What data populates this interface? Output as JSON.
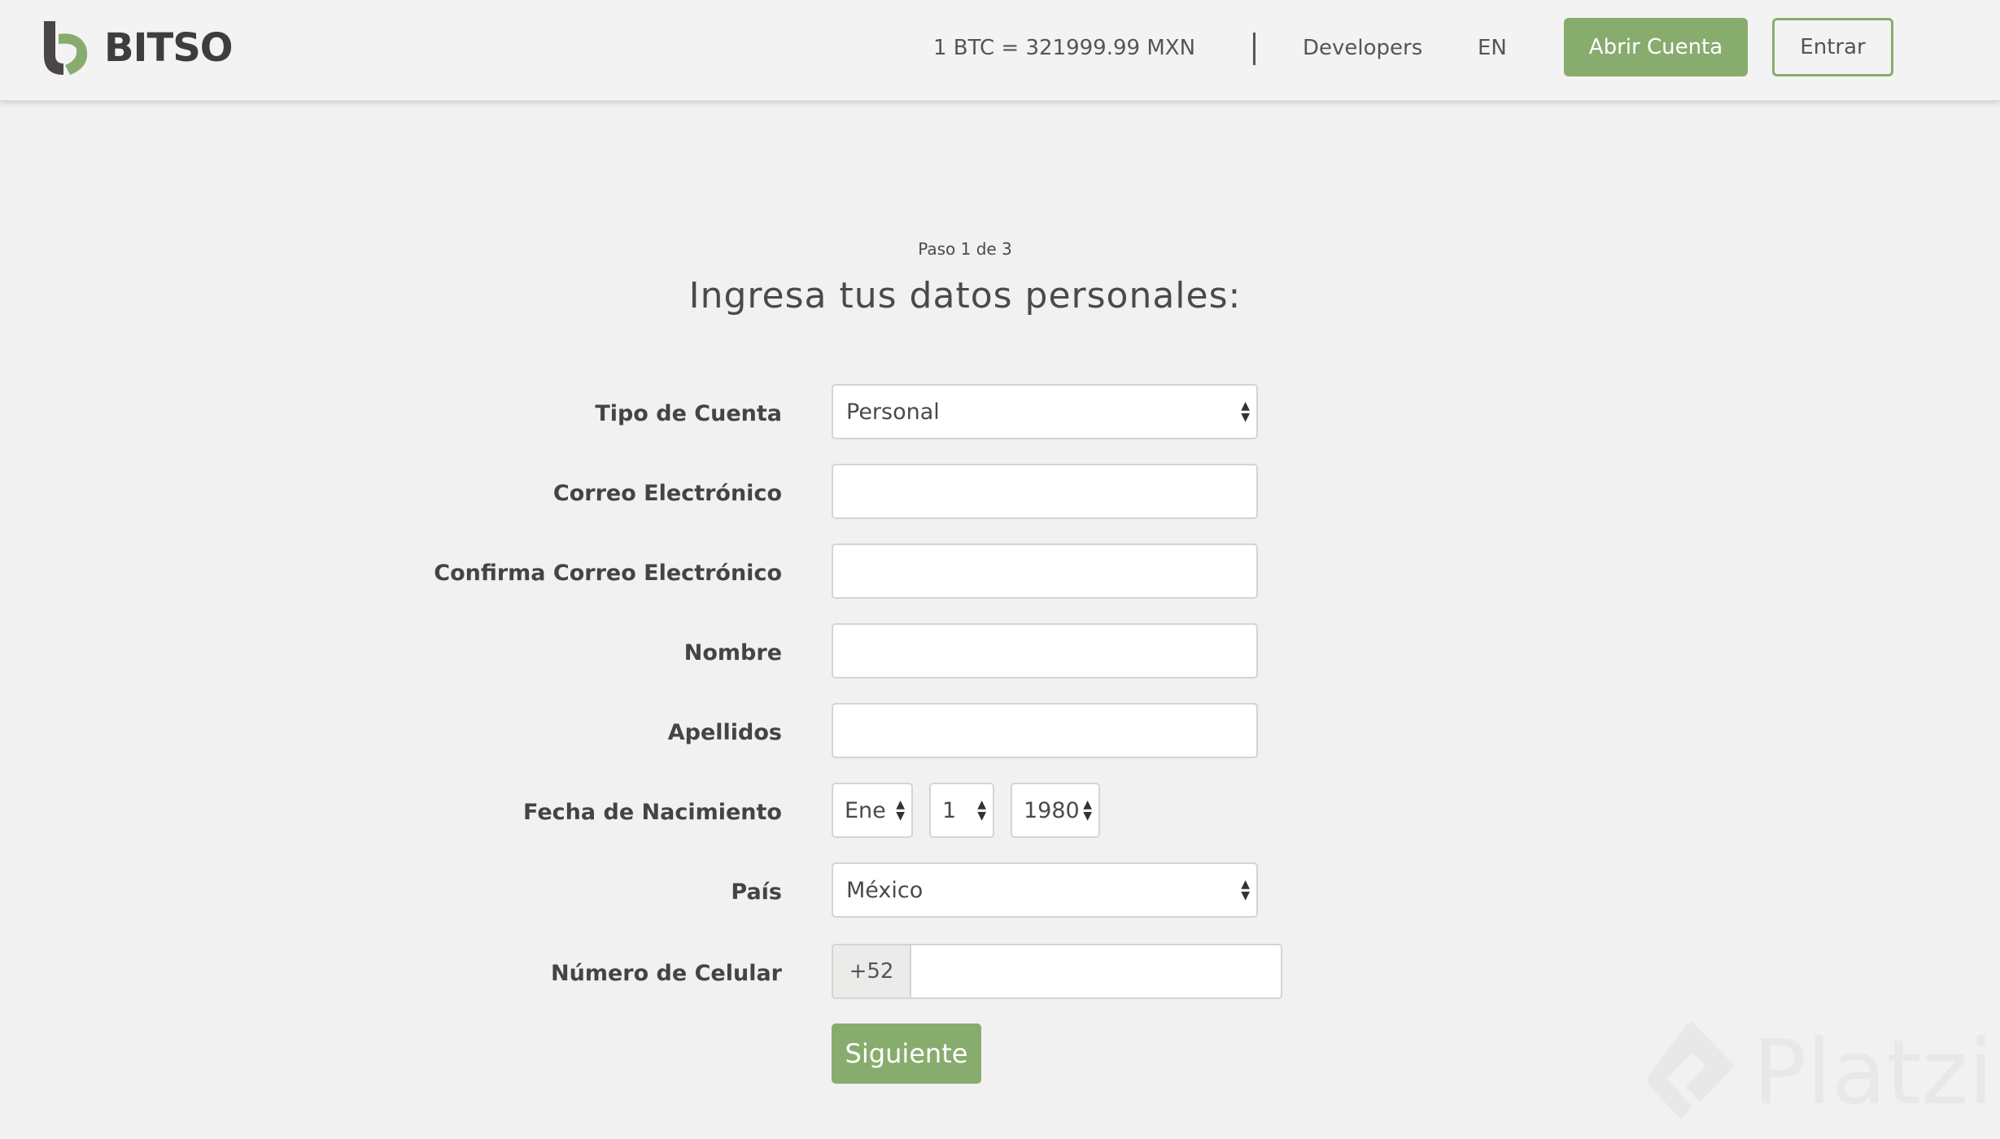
{
  "header": {
    "brand": "BITSO",
    "rate": "1 BTC = 321999.99 MXN",
    "nav": {
      "developers": "Developers",
      "language": "EN"
    },
    "open_account_label": "Abrir Cuenta",
    "login_label": "Entrar"
  },
  "form": {
    "step": "Paso 1 de 3",
    "title": "Ingresa tus datos personales:",
    "labels": {
      "account_type": "Tipo de Cuenta",
      "email": "Correo Electrónico",
      "confirm_email": "Confirma Correo Electrónico",
      "first_name": "Nombre",
      "last_name": "Apellidos",
      "birth_date": "Fecha de Nacimiento",
      "country": "País",
      "phone": "Número de Celular"
    },
    "values": {
      "account_type": "Personal",
      "email": "",
      "confirm_email": "",
      "first_name": "",
      "last_name": "",
      "birth_month": "Ene",
      "birth_day": "1",
      "birth_year": "1980",
      "country": "México",
      "phone_prefix": "+52",
      "phone": ""
    },
    "next_label": "Siguiente"
  },
  "watermark": "Platzi",
  "colors": {
    "accent": "#88ac6e",
    "background": "#f0f1f0",
    "text": "#4a4a4a"
  }
}
